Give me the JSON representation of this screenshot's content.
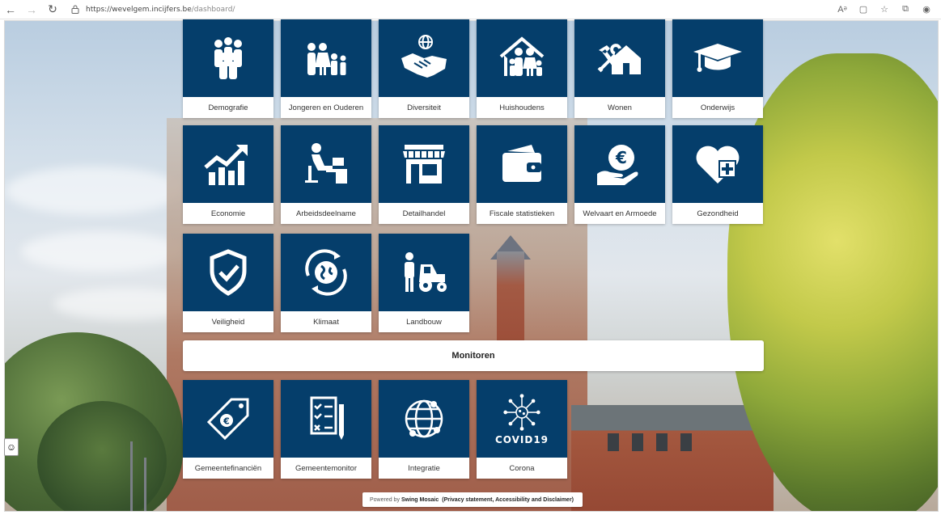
{
  "browser": {
    "url_host": "https://wevelgem.incijfers.be",
    "url_path": "/dashboard/"
  },
  "tiles_top": [
    {
      "label": "Demografie",
      "icon": "people-group-icon"
    },
    {
      "label": "Jongeren en Ouderen",
      "icon": "family-icon"
    },
    {
      "label": "Diversiteit",
      "icon": "handshake-globe-icon"
    },
    {
      "label": "Huishoudens",
      "icon": "household-icon"
    },
    {
      "label": "Wonen",
      "icon": "house-tools-icon"
    },
    {
      "label": "Onderwijs",
      "icon": "graduation-cap-icon"
    },
    {
      "label": "Economie",
      "icon": "growth-chart-icon"
    },
    {
      "label": "Arbeidsdeelname",
      "icon": "office-worker-icon"
    },
    {
      "label": "Detailhandel",
      "icon": "storefront-icon"
    },
    {
      "label": "Fiscale statistieken",
      "icon": "wallet-icon"
    },
    {
      "label": "Welvaart en Armoede",
      "icon": "euro-hand-icon"
    },
    {
      "label": "Gezondheid",
      "icon": "heart-plus-icon"
    },
    {
      "label": "Veiligheid",
      "icon": "shield-check-icon"
    },
    {
      "label": "Klimaat",
      "icon": "globe-cycle-icon"
    },
    {
      "label": "Landbouw",
      "icon": "farmer-tractor-icon"
    }
  ],
  "monitors_heading": "Monitoren",
  "tiles_monitors": [
    {
      "label": "Gemeentefinanciën",
      "icon": "euro-tag-icon"
    },
    {
      "label": "Gemeentemonitor",
      "icon": "checklist-icon"
    },
    {
      "label": "Integratie",
      "icon": "globe-people-icon"
    },
    {
      "label": "Corona",
      "icon": "covid-virus-icon",
      "icon_text": "COVID19"
    }
  ],
  "footer": {
    "prefix": "Powered by",
    "brand": "Swing Mosaic",
    "links": "(Privacy statement, Accessibility and Disclaimer)"
  },
  "colors": {
    "tile_blue": "#053e6b"
  }
}
